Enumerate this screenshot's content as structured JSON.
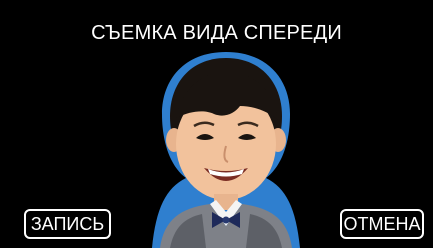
{
  "screen": {
    "title": "СЪЕМКА ВИДА СПЕРЕДИ",
    "background_color": "#000000",
    "outline_color": "#2f7fcf"
  },
  "buttons": {
    "record_label": "ЗАПИСЬ",
    "cancel_label": "ОТМЕНА"
  },
  "preview": {
    "subject": "child-portrait-front-view"
  }
}
